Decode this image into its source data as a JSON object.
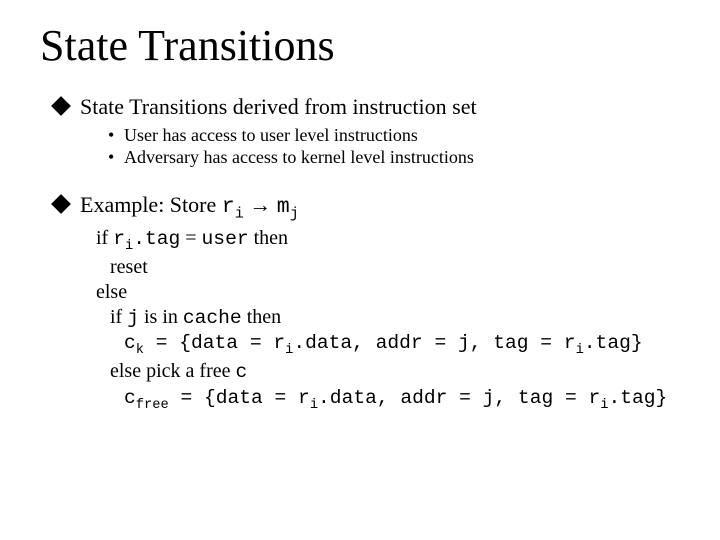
{
  "title": "State Transitions",
  "bullets": {
    "b1": {
      "text": "State Transitions derived from instruction set",
      "sub": [
        "User has access to user level instructions",
        "Adversary has access to kernel level instructions"
      ]
    },
    "b2": {
      "intro": "Example: Store ",
      "code1_base": "r",
      "code1_sub": "i",
      "arrow": " → ",
      "code2_base": "m",
      "code2_sub": "j",
      "lines": {
        "l1_a": "if ",
        "l1_b_base": "r",
        "l1_b_sub": "i",
        "l1_c": ".tag",
        "l1_d": " = ",
        "l1_e": "user",
        "l1_f": " then",
        "l2": "reset",
        "l3": "else",
        "l4_a": "if ",
        "l4_b": "j",
        "l4_c": " is in ",
        "l4_d": "cache",
        "l4_e": " then",
        "l5_a_base": "c",
        "l5_a_sub": "k",
        "l5_b": " = {data = ",
        "l5_c_base": "r",
        "l5_c_sub": "i",
        "l5_d": ".data, addr = j, tag = ",
        "l5_e_base": "r",
        "l5_e_sub": "i",
        "l5_f": ".tag}",
        "l6_a": "else pick a free ",
        "l6_b": "c",
        "l7_a_base": "c",
        "l7_a_sub": "free",
        "l7_b": " = {data = ",
        "l7_c_base": "r",
        "l7_c_sub": "i",
        "l7_d": ".data, addr = j, tag = ",
        "l7_e_base": "r",
        "l7_e_sub": "i",
        "l7_f": ".tag}"
      }
    }
  }
}
